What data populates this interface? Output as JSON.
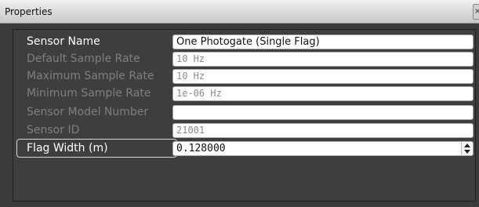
{
  "window": {
    "title": "Properties",
    "close_glyph": "×"
  },
  "properties": [
    {
      "label": "Sensor Name",
      "value": "One Photogate (Single Flag)",
      "editable": true,
      "kind": "text"
    },
    {
      "label": "Default Sample Rate",
      "value": "10 Hz",
      "editable": false,
      "kind": "text"
    },
    {
      "label": "Maximum Sample Rate",
      "value": "10 Hz",
      "editable": false,
      "kind": "text"
    },
    {
      "label": "Minimum Sample Rate",
      "value": "1e-06 Hz",
      "editable": false,
      "kind": "text"
    },
    {
      "label": "Sensor Model Number",
      "value": "",
      "editable": false,
      "kind": "text"
    },
    {
      "label": "Sensor ID",
      "value": "21001",
      "editable": false,
      "kind": "text"
    },
    {
      "label": "Flag Width (m)",
      "value": "0.128000",
      "editable": true,
      "kind": "spinbox"
    }
  ]
}
